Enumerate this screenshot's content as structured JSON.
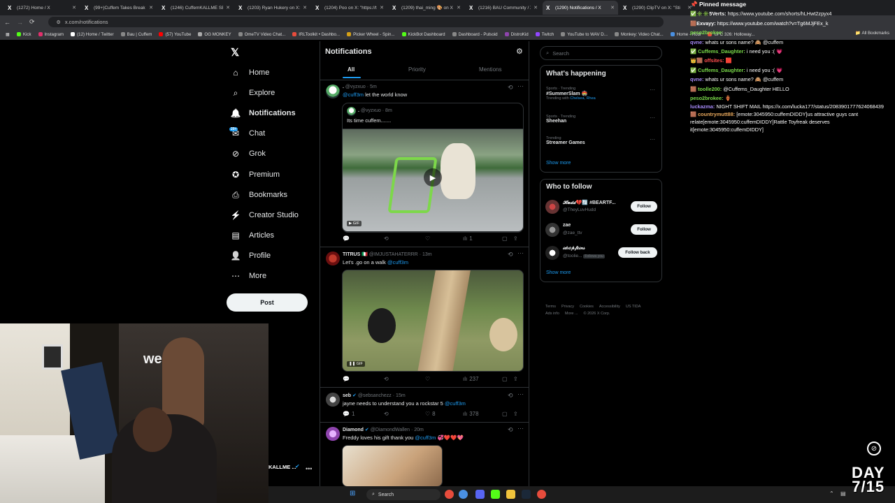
{
  "browser": {
    "tabs": [
      {
        "label": "(1272) Home / X",
        "active": false
      },
      {
        "label": "(99+)Cuffem Takes Break A",
        "active": false
      },
      {
        "label": "(1246) CuffemKALLME SEN",
        "active": false
      },
      {
        "label": "(1203) Ryan Hukery on X: '",
        "active": false
      },
      {
        "label": "(1204) Poo on X: \"https://t",
        "active": false
      },
      {
        "label": "(1209) thai_ming 🎨 on X",
        "active": false
      },
      {
        "label": "(1216) BAU Community / X",
        "active": false
      },
      {
        "label": "(1290) Notifications / X",
        "active": true
      },
      {
        "label": "(1290) ClipTV on X: \"Sti",
        "active": false
      }
    ],
    "url": "x.com/notifications",
    "bookmarks": [
      "Kick",
      "Instagram",
      "(12) Home / Twitter",
      "Bau | Cuffem",
      "(57) YouTube",
      "OG MONKEY",
      "OmeTV Video Chat...",
      "IRLToolkit • Dashbo...",
      "Picker Wheel - Spin...",
      "KickBot Dashboard",
      "Dashboard - Pulsoid",
      "DistroKid",
      "Twitch",
      "YouTube to WAV D...",
      "Monkey: Video Chat...",
      "Home - Robl",
      "UFC 326: Holloway..."
    ],
    "all_bookmarks": "All Bookmarks"
  },
  "nav": {
    "items": [
      {
        "label": "Home",
        "icon": "home-icon"
      },
      {
        "label": "Explore",
        "icon": "search-icon"
      },
      {
        "label": "Notifications",
        "icon": "bell-icon"
      },
      {
        "label": "Chat",
        "icon": "chat-icon"
      },
      {
        "label": "Grok",
        "icon": "grok-icon"
      },
      {
        "label": "Premium",
        "icon": "premium-icon"
      },
      {
        "label": "Bookmarks",
        "icon": "bookmark-icon"
      },
      {
        "label": "Creator Studio",
        "icon": "creator-studio-icon"
      },
      {
        "label": "Articles",
        "icon": "articles-icon"
      },
      {
        "label": "Profile",
        "icon": "profile-icon"
      },
      {
        "label": "More",
        "icon": "more-icon"
      }
    ],
    "chat_badge": "20+",
    "post": "Post",
    "account_name": "KALLME ..."
  },
  "notifications": {
    "title": "Notifications",
    "tabs": [
      "All",
      "Priority",
      "Mentions"
    ],
    "posts": [
      {
        "name": ".",
        "handle": "@vyzxuo",
        "time": "5m",
        "mention": "@cuff3m",
        "text": "let the world know",
        "quote": {
          "name": ".",
          "handle": "@vyzxuo",
          "time": "8m",
          "text": "Its time cuffem.......",
          "badge": "GIF"
        },
        "views": "1"
      },
      {
        "name": "TITRUS 🇮🇹",
        "handle": "@IMJUSTAHATERRR",
        "time": "13m",
        "text": "Let's .go on a walk",
        "mention": "@cuff3m",
        "badge": "GIF",
        "views": "237"
      },
      {
        "name": "seb",
        "handle": "@sebsanchezz",
        "time": "15m",
        "text": "jayne needs to understand you a rockstar 5",
        "mention": "@cuff3m",
        "replies": "1",
        "likes": "8",
        "views": "378"
      },
      {
        "name": "Diamond",
        "handle": "@DiamondWallen",
        "time": "20m",
        "text": "Freddy loves his gift thank you",
        "mention": "@cuff3m",
        "emojis": "💞❤️❤️💖"
      }
    ]
  },
  "right": {
    "search_placeholder": "Search",
    "happening_title": "What's happening",
    "trends": [
      {
        "category": "Sports · Trending",
        "name": "#SummerSlam 🏟️",
        "sub": "Trending with",
        "with": "Chelsea, Rhea"
      },
      {
        "category": "Sports · Trending",
        "name": "Sheehan",
        "sub": "",
        "with": ""
      },
      {
        "category": "Trending",
        "name": "Streamer Games",
        "sub": "",
        "with": ""
      }
    ],
    "show_more": "Show more",
    "follow_title": "Who to follow",
    "follow": [
      {
        "name": "𝓗𝓾𝓭𝓭💔🔄 #BEARTF...",
        "handle": "@TheyLuvHudd",
        "button": "Follow"
      },
      {
        "name": "zae",
        "handle": "@zae_ttv",
        "button": "Follow"
      },
      {
        "name": "𝒾𝒹𝓇𝑜𝓅𝒻𝑒𝒾𝓃𝓈",
        "handle": "@toolie...",
        "follows_you": "Follows you",
        "button": "Follow back"
      }
    ],
    "footer": [
      "Terms",
      "Privacy",
      "Cookies",
      "Accessibility",
      "US TIDA",
      "Ads info",
      "More ...",
      "© 2026 X Corp."
    ]
  },
  "chat": {
    "pinned": "Pinned message",
    "messages": [
      {
        "user": "✅✳️✳️5Verts:",
        "text": "https://www.youtube.com/shorts/hLHwt2zpyx4",
        "color": "#ffffff"
      },
      {
        "user": "🟫Exvayy:",
        "text": "https://www.youtube.com/watch?v=Tg6MJjFEx_k",
        "color": "#ffffff"
      },
      {
        "user": "peso2brokee:",
        "text": "",
        "color": "#7bdc4a"
      },
      {
        "user": "qvne:",
        "text": "whats ur sons name? 🙈 @cuffem",
        "color": "#a78bfa"
      },
      {
        "user": "✅ Cuffems_Daughter:",
        "text": "i need you :( 💗",
        "color": "#7bdc4a"
      },
      {
        "user": "👑🟫 offsites:",
        "text": "🟥",
        "color": "#ff4d4d"
      },
      {
        "user": "✅ Cuffems_Daughter:",
        "text": "i need you :( 💗",
        "color": "#7bdc4a"
      },
      {
        "user": "qvne:",
        "text": "whats ur sons name? 🙈 @cuffem",
        "color": "#a78bfa"
      },
      {
        "user": "🟫 toolle200:",
        "text": "@Cuffems_Daughter HELLO",
        "color": "#7bdc4a"
      },
      {
        "user": "peso2brokee:",
        "text": "🏺",
        "color": "#7bdc4a"
      },
      {
        "user": "luckazma:",
        "text": "NIGHT SHIFT MAIL https://x.com/lucka177/status/2083901777624068439",
        "color": "#a78bfa"
      },
      {
        "user": "🟫 countrymutt88:",
        "text": "[emote:3045950:cuffemDIDDY]us attractive guys cant relate[emote:3045950:cuffemDIDDY]Rattle Toyfreak deserves it[emote:3045950:cuffemDIDDY]",
        "color": "#e8a85c"
      }
    ]
  },
  "taskbar": {
    "search": "Search"
  },
  "overlay": {
    "line1": "DAY",
    "line2": "7/15"
  }
}
